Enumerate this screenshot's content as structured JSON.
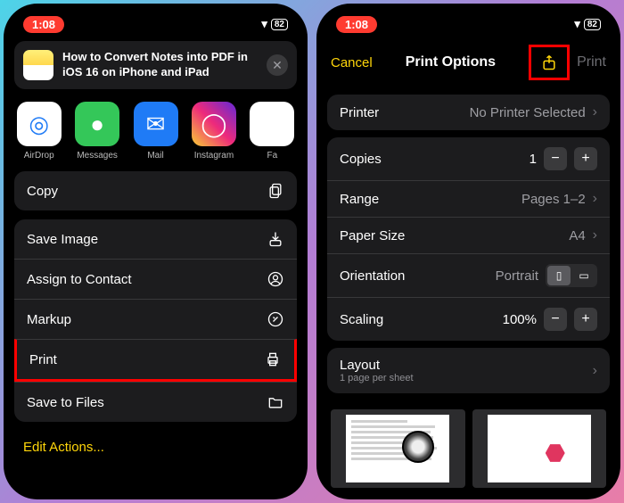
{
  "status": {
    "time": "1:08",
    "battery": "82"
  },
  "share": {
    "note_title": "How to Convert Notes into PDF in iOS 16 on iPhone and iPad",
    "apps": [
      {
        "name": "AirDrop",
        "bg": "#fff",
        "glyph": "◎"
      },
      {
        "name": "Messages",
        "bg": "#34c759",
        "glyph": "💬"
      },
      {
        "name": "Mail",
        "bg": "#1f7bf6",
        "glyph": "✉"
      },
      {
        "name": "Instagram",
        "bg": "linear-gradient(45deg,#f9ce34,#ee2a7b,#6228d7)",
        "glyph": "◯"
      },
      {
        "name": "Fa",
        "bg": "#fff",
        "glyph": ""
      }
    ],
    "actions": {
      "copy": "Copy",
      "save_image": "Save Image",
      "assign": "Assign to Contact",
      "markup": "Markup",
      "print": "Print",
      "save_files": "Save to Files"
    },
    "edit_actions": "Edit Actions..."
  },
  "print": {
    "cancel": "Cancel",
    "title": "Print Options",
    "print_btn": "Print",
    "printer_label": "Printer",
    "printer_value": "No Printer Selected",
    "copies_label": "Copies",
    "copies_value": "1",
    "range_label": "Range",
    "range_value": "Pages 1–2",
    "paper_label": "Paper Size",
    "paper_value": "A4",
    "orient_label": "Orientation",
    "orient_value": "Portrait",
    "scaling_label": "Scaling",
    "scaling_value": "100%",
    "layout_label": "Layout",
    "layout_sub": "1 page per sheet"
  }
}
